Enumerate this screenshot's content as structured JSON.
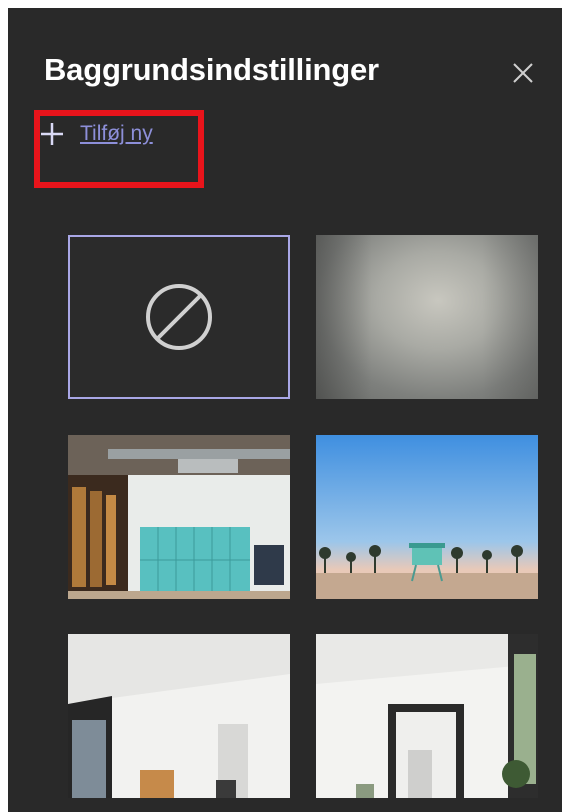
{
  "panel": {
    "title": "Baggrundsindstillinger",
    "close_icon": "close-icon",
    "add_new": {
      "icon": "plus-icon",
      "label": "Tilføj ny"
    }
  },
  "colors": {
    "panel_bg": "#292929",
    "accent": "#8d8fd9",
    "selected_border": "#a9a7e6",
    "highlight": "#e8141b"
  },
  "backgrounds": [
    {
      "id": "none",
      "kind": "no-background",
      "icon": "no-entry-icon",
      "selected": true
    },
    {
      "id": "blur",
      "kind": "blur",
      "selected": false
    },
    {
      "id": "office",
      "kind": "image",
      "scene": "office-with-lockers",
      "selected": false
    },
    {
      "id": "beach",
      "kind": "image",
      "scene": "beach-lifeguard-tower",
      "selected": false
    },
    {
      "id": "room1",
      "kind": "image",
      "scene": "bright-room-window",
      "selected": false
    },
    {
      "id": "room2",
      "kind": "image",
      "scene": "bright-room-mirror",
      "selected": false
    }
  ]
}
